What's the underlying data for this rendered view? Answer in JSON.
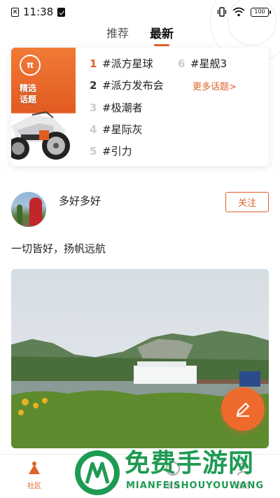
{
  "status_bar": {
    "time": "11:38",
    "battery": "100"
  },
  "tabs": [
    {
      "label": "推荐",
      "active": false
    },
    {
      "label": "最新",
      "active": true
    }
  ],
  "topics_card": {
    "banner_title_line1": "精选",
    "banner_title_line2": "话题",
    "logo_text": "π",
    "items": [
      {
        "rank": "1",
        "label": "#派方星球"
      },
      {
        "rank": "2",
        "label": "#派方发布会"
      },
      {
        "rank": "3",
        "label": "#极潮者"
      },
      {
        "rank": "4",
        "label": "#星际灰"
      },
      {
        "rank": "5",
        "label": "#引力"
      },
      {
        "rank": "6",
        "label": "#星舰3"
      }
    ],
    "more_link": "更多话题>"
  },
  "post": {
    "username": "多好多好",
    "follow_label": "关注",
    "text": "一切皆好，扬帆远航"
  },
  "bottom_nav": [
    {
      "label": "社区",
      "active": true,
      "icon": "community-icon"
    },
    {
      "label": "发现",
      "active": false,
      "icon": "discover-icon"
    },
    {
      "label": "我的",
      "active": false,
      "icon": "profile-icon"
    }
  ],
  "watermark": {
    "cn": "免费手游网",
    "en": "MIANFEISHOUYOUWANG"
  },
  "colors": {
    "accent": "#e0622a",
    "watermark": "#1f9a53"
  }
}
